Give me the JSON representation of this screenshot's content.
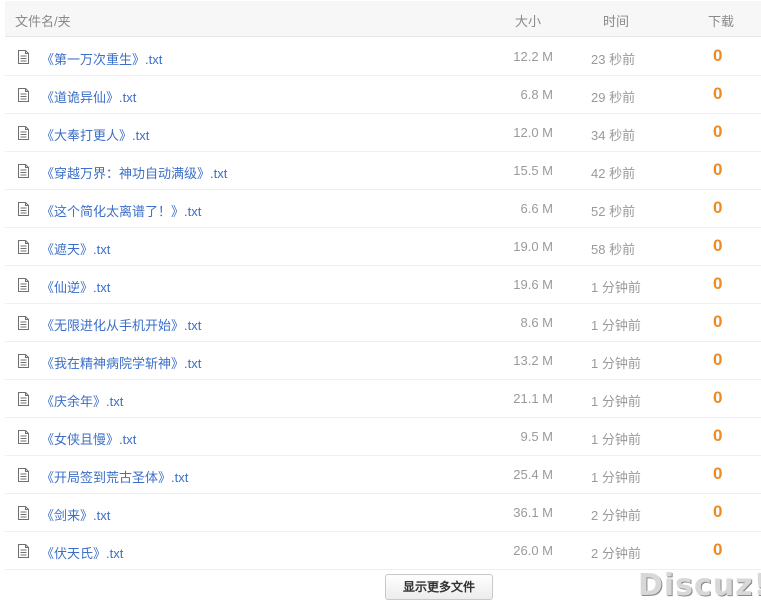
{
  "header": {
    "name_label": "文件名/夹",
    "size_label": "大小",
    "time_label": "时间",
    "download_label": "下载"
  },
  "files": [
    {
      "name": "《第一万次重生》.txt",
      "size": "12.2 M",
      "time": "23 秒前",
      "downloads": "0"
    },
    {
      "name": "《道诡异仙》.txt",
      "size": "6.8 M",
      "time": "29 秒前",
      "downloads": "0"
    },
    {
      "name": "《大奉打更人》.txt",
      "size": "12.0 M",
      "time": "34 秒前",
      "downloads": "0"
    },
    {
      "name": "《穿越万界：神功自动满级》.txt",
      "size": "15.5 M",
      "time": "42 秒前",
      "downloads": "0"
    },
    {
      "name": "《这个简化太离谱了！》.txt",
      "size": "6.6 M",
      "time": "52 秒前",
      "downloads": "0"
    },
    {
      "name": "《遮天》.txt",
      "size": "19.0 M",
      "time": "58 秒前",
      "downloads": "0"
    },
    {
      "name": "《仙逆》.txt",
      "size": "19.6 M",
      "time": "1 分钟前",
      "downloads": "0"
    },
    {
      "name": "《无限进化从手机开始》.txt",
      "size": "8.6 M",
      "time": "1 分钟前",
      "downloads": "0"
    },
    {
      "name": "《我在精神病院学斩神》.txt",
      "size": "13.2 M",
      "time": "1 分钟前",
      "downloads": "0"
    },
    {
      "name": "《庆余年》.txt",
      "size": "21.1 M",
      "time": "1 分钟前",
      "downloads": "0"
    },
    {
      "name": "《女侠且慢》.txt",
      "size": "9.5 M",
      "time": "1 分钟前",
      "downloads": "0"
    },
    {
      "name": "《开局签到荒古圣体》.txt",
      "size": "25.4 M",
      "time": "1 分钟前",
      "downloads": "0"
    },
    {
      "name": "《剑来》.txt",
      "size": "36.1 M",
      "time": "2 分钟前",
      "downloads": "0"
    },
    {
      "name": "《伏天氏》.txt",
      "size": "26.0 M",
      "time": "2 分钟前",
      "downloads": "0"
    }
  ],
  "footer": {
    "more_button_label": "显示更多文件",
    "watermark": "Discuz!"
  },
  "colors": {
    "link": "#3b6fc9",
    "download_count": "#f08a1e",
    "muted_text": "#9a9a9a"
  },
  "icons": {
    "file": "document-icon"
  }
}
